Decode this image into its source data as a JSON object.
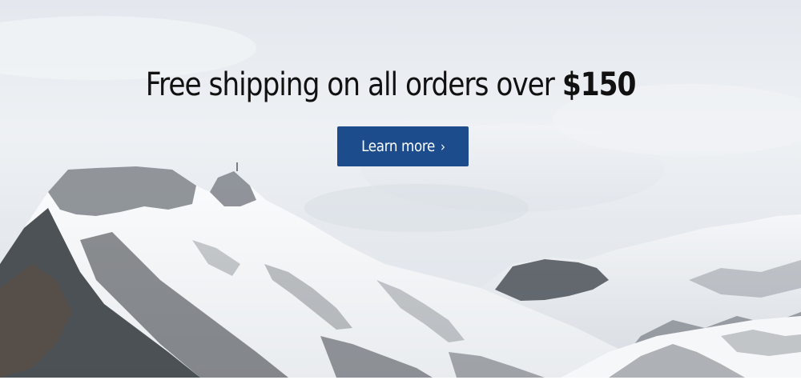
{
  "promo": {
    "headline_text": "Free shipping on all orders over ",
    "headline_price": "$150",
    "cta_label": "Learn more",
    "cta_chevron": "›",
    "cta_color": "#1c4c8c"
  },
  "hero": {
    "image_subject": "snow-covered-mountains-icon"
  }
}
